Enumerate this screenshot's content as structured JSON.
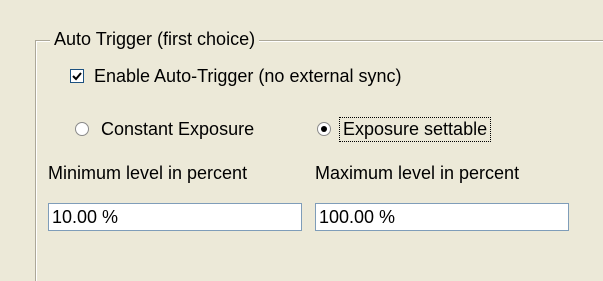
{
  "group": {
    "title": "Auto Trigger (first choice)"
  },
  "auto_trigger": {
    "label": "Enable Auto-Trigger (no external sync)",
    "checked": true
  },
  "exposure_mode": {
    "options": [
      {
        "label": "Constant Exposure",
        "selected": false
      },
      {
        "label": "Exposure settable",
        "selected": true,
        "focused": true
      }
    ]
  },
  "min_level": {
    "label": "Minimum level in percent",
    "value": "10.00 %"
  },
  "max_level": {
    "label": "Maximum level in percent",
    "value": "100.00 %"
  },
  "colors": {
    "dialog_background": "#ece9d8",
    "input_border": "#7f9db9",
    "group_border": "#aca899"
  },
  "icons": {
    "checkbox_check": "check-icon",
    "radio_selected": "radio-dot-icon"
  }
}
